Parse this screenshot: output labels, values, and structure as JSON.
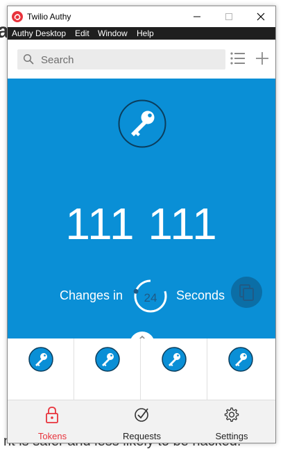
{
  "window": {
    "title": "Twilio Authy"
  },
  "menubar": {
    "items": [
      "Authy Desktop",
      "Edit",
      "Window",
      "Help"
    ]
  },
  "search": {
    "placeholder": "Search"
  },
  "token": {
    "code": "111 111",
    "changes_label": "Changes in",
    "seconds_remaining": "24",
    "timer_fraction_remaining": 0.8,
    "seconds_label": "Seconds"
  },
  "token_tiles": [
    {
      "icon": "key-icon"
    },
    {
      "icon": "key-icon"
    },
    {
      "icon": "key-icon"
    },
    {
      "icon": "key-icon"
    }
  ],
  "bottom_nav": {
    "tokens": "Tokens",
    "requests": "Requests",
    "settings": "Settings",
    "active": "tokens"
  },
  "colors": {
    "brand": "#0a8fd6",
    "brand_dark": "#0b6ea6",
    "accent_red": "#e8333c",
    "menubar": "#1f1f1f"
  },
  "background_text": {
    "frag_a": "a",
    "frag_line": "nt is safer and less likely to be hacked."
  }
}
